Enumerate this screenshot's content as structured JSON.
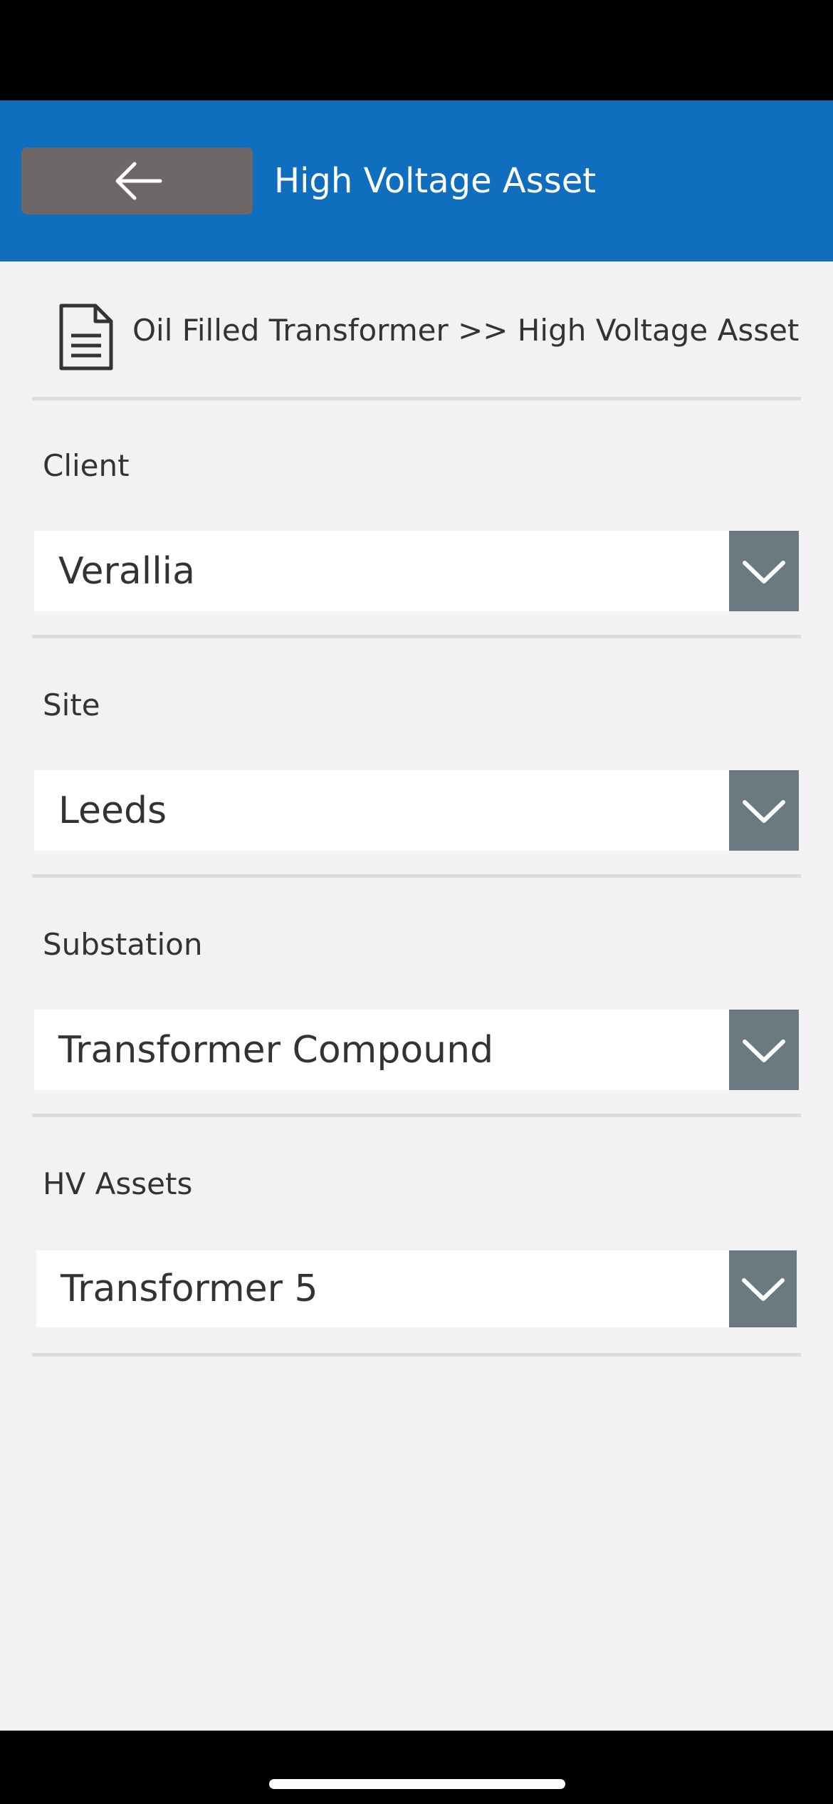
{
  "header": {
    "title": "High Voltage Asset",
    "back_icon": "arrow-left-icon",
    "background_color": "#106ebe",
    "back_button_color": "#6e6767"
  },
  "breadcrumb": {
    "icon": "document-icon",
    "text": "Oil Filled Transformer >> High Voltage Asset"
  },
  "fields": [
    {
      "label": "Client",
      "value": "Verallia"
    },
    {
      "label": "Site",
      "value": "Leeds"
    },
    {
      "label": "Substation",
      "value": "Transformer Compound"
    },
    {
      "label": "HV Assets",
      "value": "Transformer 5"
    }
  ],
  "dropdown_icon": "chevron-down-icon",
  "colors": {
    "content_background": "#f2f2f2",
    "chevron_background": "#6b7a80",
    "divider": "#d8dde0"
  }
}
